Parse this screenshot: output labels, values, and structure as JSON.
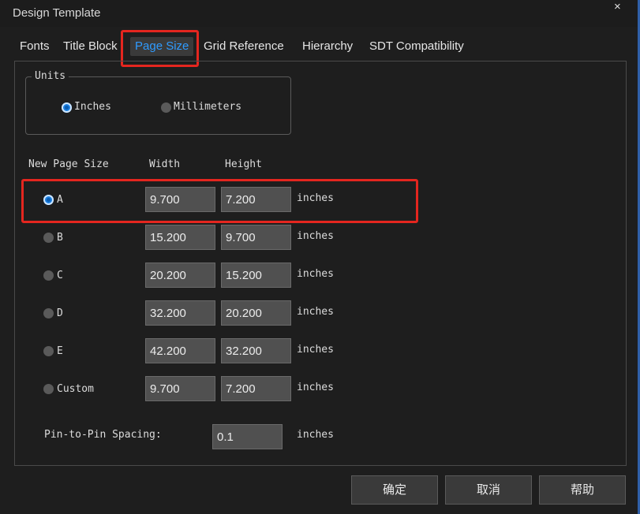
{
  "window": {
    "title": "Design Template",
    "close_glyph": "×"
  },
  "tabs": [
    {
      "label": "Fonts"
    },
    {
      "label": "Title Block"
    },
    {
      "label": "Page Size",
      "active": true
    },
    {
      "label": "Grid Reference"
    },
    {
      "label": "Hierarchy"
    },
    {
      "label": "SDT Compatibility"
    }
  ],
  "units": {
    "legend": "Units",
    "options": [
      {
        "label": "Inches",
        "selected": true
      },
      {
        "label": "Millimeters",
        "selected": false
      }
    ]
  },
  "table": {
    "headers": {
      "size": "New Page Size",
      "width": "Width",
      "height": "Height"
    },
    "rows": [
      {
        "label": "A",
        "width": "9.700",
        "height": "7.200",
        "unit": "inches",
        "selected": true
      },
      {
        "label": "B",
        "width": "15.200",
        "height": "9.700",
        "unit": "inches",
        "selected": false
      },
      {
        "label": "C",
        "width": "20.200",
        "height": "15.200",
        "unit": "inches",
        "selected": false
      },
      {
        "label": "D",
        "width": "32.200",
        "height": "20.200",
        "unit": "inches",
        "selected": false
      },
      {
        "label": "E",
        "width": "42.200",
        "height": "32.200",
        "unit": "inches",
        "selected": false
      },
      {
        "label": "Custom",
        "width": "9.700",
        "height": "7.200",
        "unit": "inches",
        "selected": false
      }
    ]
  },
  "spacing": {
    "label": "Pin-to-Pin Spacing:",
    "value": "0.1",
    "unit": "inches"
  },
  "buttons": {
    "ok": "确定",
    "cancel": "取消",
    "help": "帮助"
  },
  "colors": {
    "accent": "#2f9bff",
    "highlight": "#e4261f",
    "background": "#1e1e1e"
  }
}
